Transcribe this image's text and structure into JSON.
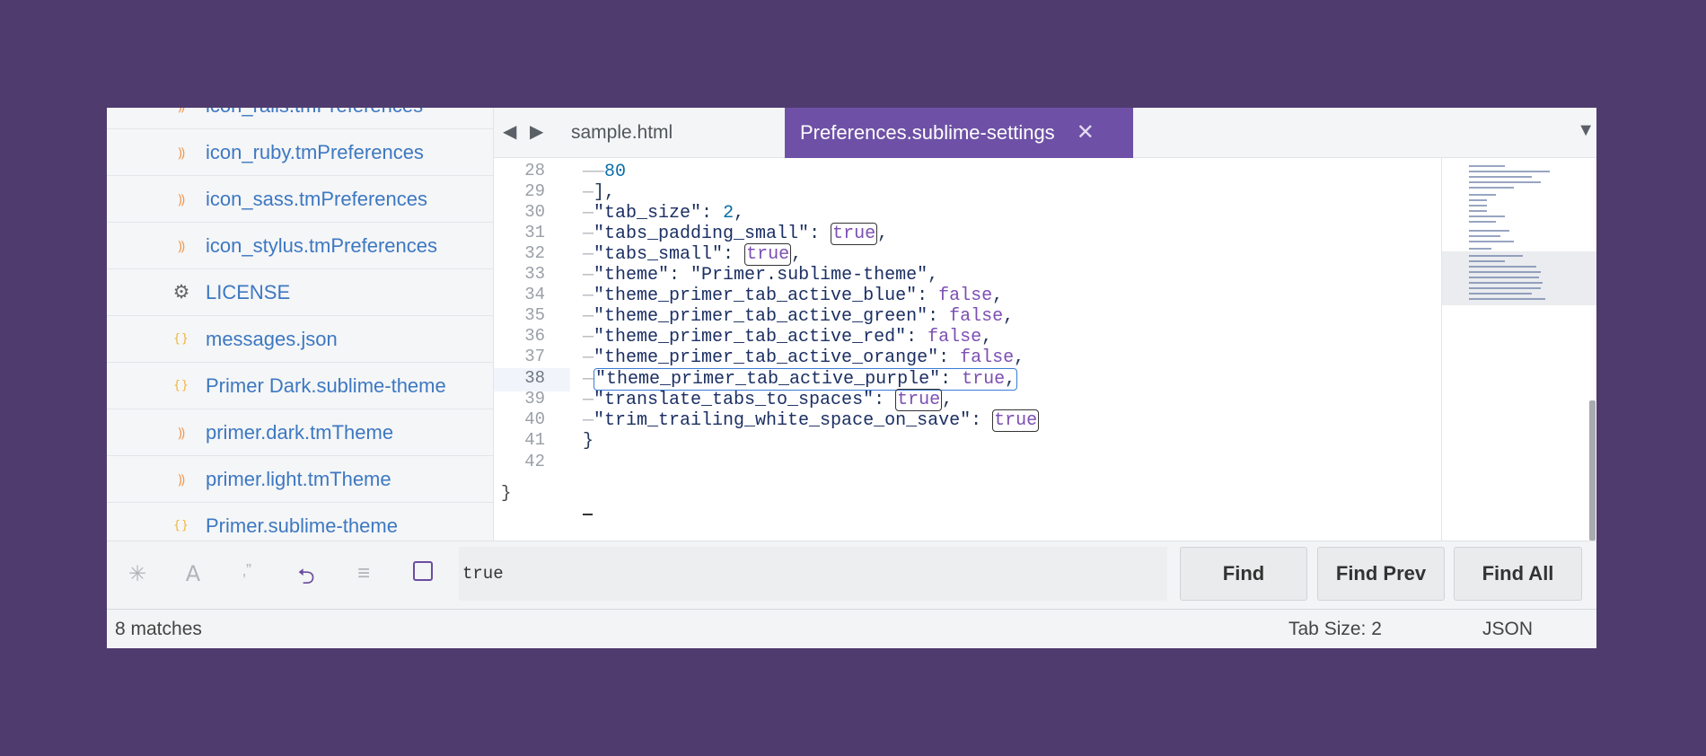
{
  "sidebar": {
    "items": [
      {
        "label": "icon_rails.tmPreferences",
        "icon": "rss-icon"
      },
      {
        "label": "icon_ruby.tmPreferences",
        "icon": "rss-icon"
      },
      {
        "label": "icon_sass.tmPreferences",
        "icon": "rss-icon"
      },
      {
        "label": "icon_stylus.tmPreferences",
        "icon": "rss-icon"
      },
      {
        "label": "LICENSE",
        "icon": "gear-icon"
      },
      {
        "label": "messages.json",
        "icon": "braces-icon"
      },
      {
        "label": "Primer Dark.sublime-theme",
        "icon": "braces-icon"
      },
      {
        "label": "primer.dark.tmTheme",
        "icon": "rss-icon"
      },
      {
        "label": "primer.light.tmTheme",
        "icon": "rss-icon"
      },
      {
        "label": "Primer.sublime-theme",
        "icon": "braces-icon"
      }
    ]
  },
  "tabs": {
    "items": [
      {
        "label": "sample.html",
        "active": false
      },
      {
        "label": "Preferences.sublime-settings",
        "active": true
      }
    ]
  },
  "editor": {
    "line_numbers": [
      "28",
      "29",
      "30",
      "31",
      "32",
      "33",
      "34",
      "35",
      "36",
      "37",
      "38",
      "39",
      "40",
      "41",
      "42"
    ],
    "current_line": "38",
    "lines": [
      "80",
      "],",
      "\"tab_size\": 2,",
      "\"tabs_padding_small\": true,",
      "\"tabs_small\": true,",
      "\"theme\": \"Primer.sublime-theme\",",
      "\"theme_primer_tab_active_blue\": false,",
      "\"theme_primer_tab_active_green\": false,",
      "\"theme_primer_tab_active_red\": false,",
      "\"theme_primer_tab_active_orange\": false,",
      "\"theme_primer_tab_active_purple\": true,",
      "\"translate_tabs_to_spaces\": true,",
      "\"trim_trailing_white_space_on_save\": true",
      "}",
      ""
    ],
    "tokens": {
      "number_80": "80",
      "close_bracket": "],",
      "key_tab_size": "\"tab_size\"",
      "val_tab_size": "2",
      "key_tabs_padding_small": "\"tabs_padding_small\"",
      "key_tabs_small": "\"tabs_small\"",
      "key_theme": "\"theme\"",
      "val_theme": "\"Primer.sublime-theme\"",
      "key_blue": "\"theme_primer_tab_active_blue\"",
      "key_green": "\"theme_primer_tab_active_green\"",
      "key_red": "\"theme_primer_tab_active_red\"",
      "key_orange": "\"theme_primer_tab_active_orange\"",
      "key_purple": "\"theme_primer_tab_active_purple\"",
      "key_translate": "\"translate_tabs_to_spaces\"",
      "key_trim": "\"trim_trailing_white_space_on_save\"",
      "true": "true",
      "false": "false",
      "close_brace": "}",
      "fold_brace": "}"
    }
  },
  "find_panel": {
    "options": [
      {
        "name": "regex",
        "icon": "asterisk-icon",
        "glyph": "✳",
        "active": false
      },
      {
        "name": "case",
        "icon": "case-sensitive-icon",
        "glyph": "A",
        "active": false
      },
      {
        "name": "whole-word",
        "icon": "whole-word-icon",
        "glyph": "‚”",
        "active": false
      },
      {
        "name": "wrap",
        "icon": "wrap-icon",
        "glyph": "⮌",
        "active": true
      },
      {
        "name": "in-selection",
        "icon": "selection-icon",
        "glyph": "≡",
        "active": false
      },
      {
        "name": "highlight",
        "icon": "highlight-matches-icon",
        "glyph": "",
        "active": true
      }
    ],
    "query": "true",
    "buttons": {
      "find": "Find",
      "find_prev": "Find Prev",
      "find_all": "Find All"
    }
  },
  "status_bar": {
    "matches": "8 matches",
    "tab_size": "Tab Size: 2",
    "syntax": "JSON"
  },
  "colors": {
    "background": "#4f3b6e",
    "active_tab": "#6e51a6",
    "link_blue": "#3d78c2",
    "keyword_purple": "#7c4fb3",
    "number_blue": "#0b6ea8"
  }
}
